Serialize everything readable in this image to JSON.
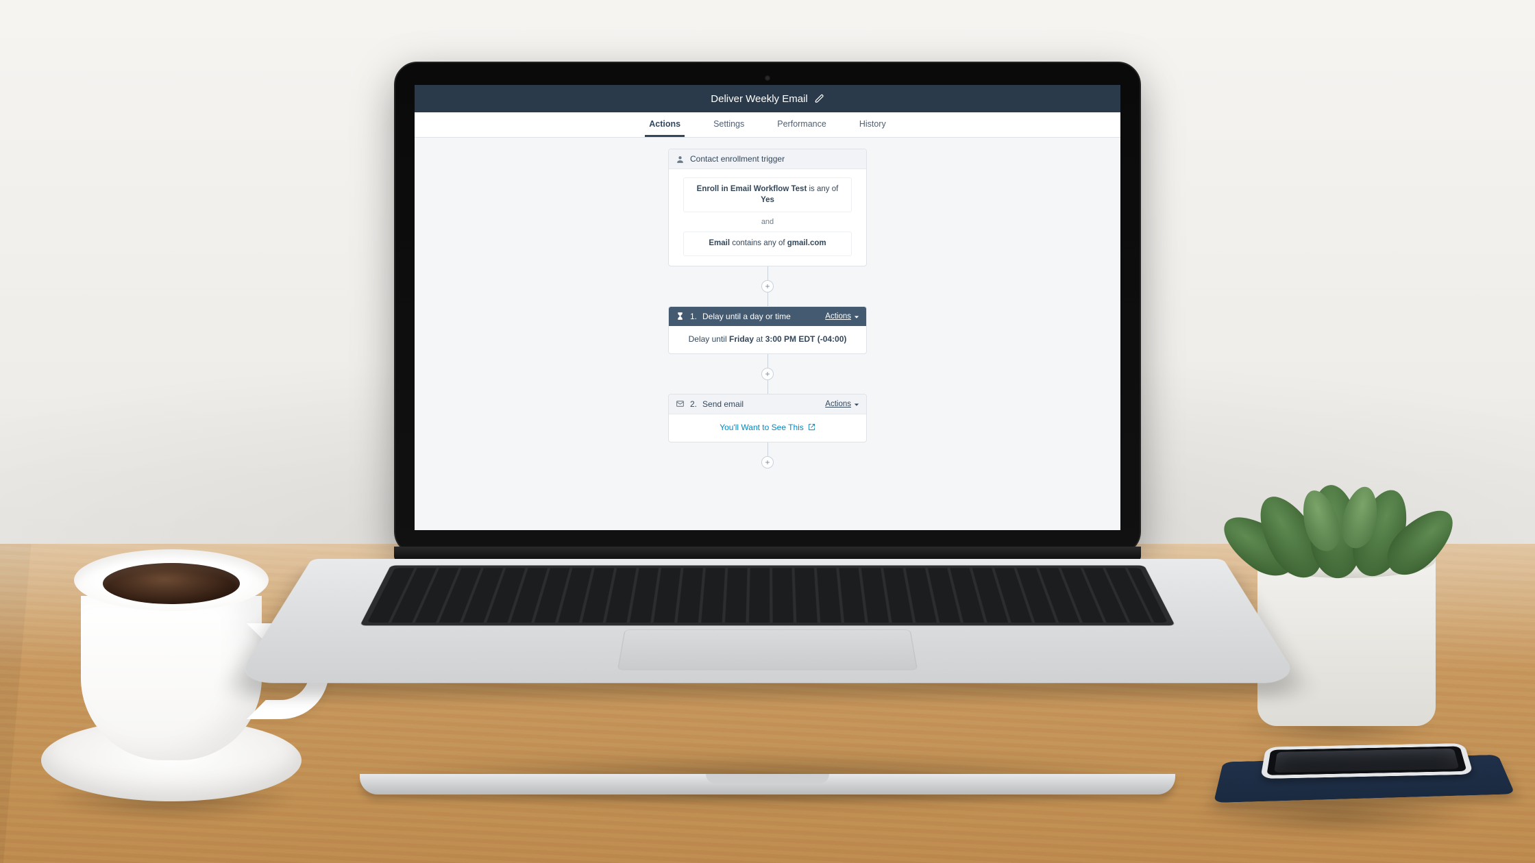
{
  "header": {
    "title": "Deliver Weekly Email"
  },
  "tabs": [
    {
      "label": "Actions",
      "active": true
    },
    {
      "label": "Settings",
      "active": false
    },
    {
      "label": "Performance",
      "active": false
    },
    {
      "label": "History",
      "active": false
    }
  ],
  "trigger": {
    "title": "Contact enrollment trigger",
    "rules": [
      {
        "field": "Enroll in Email Workflow Test",
        "op": " is any of ",
        "value": "Yes"
      },
      {
        "field": "Email",
        "op": " contains any of ",
        "value": "gmail.com"
      }
    ],
    "joiner": "and"
  },
  "steps": [
    {
      "index": "1.",
      "title": "Delay until a day or time",
      "actions_label": "Actions",
      "text_prefix": "Delay until ",
      "text_day": "Friday",
      "text_middle": " at ",
      "text_time": "3:00 PM EDT (-04:00)"
    },
    {
      "index": "2.",
      "title": "Send email",
      "actions_label": "Actions",
      "link_text": "You'll Want to See This"
    }
  ],
  "add_button": "+"
}
